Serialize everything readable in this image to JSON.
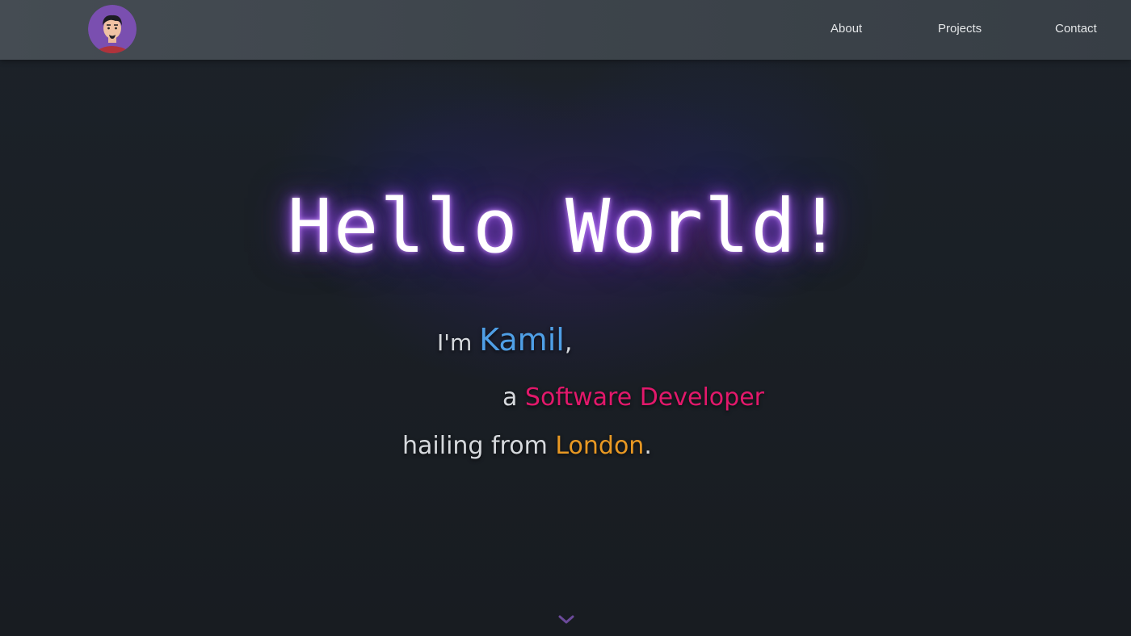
{
  "nav": {
    "links": [
      {
        "label": "About"
      },
      {
        "label": "Projects"
      },
      {
        "label": "Contact"
      }
    ]
  },
  "hero": {
    "title": "Hello World!",
    "line1": {
      "prefix": "I'm ",
      "name": "Kamil",
      "suffix": ","
    },
    "line2": {
      "prefix": "a ",
      "role": "Software Developer"
    },
    "line3": {
      "prefix": "hailing from ",
      "city": "London",
      "suffix": "."
    }
  },
  "colors": {
    "name": "#4f9fe6",
    "role": "#e2186b",
    "city": "#e89823",
    "glow": "#a85cff"
  },
  "icons": {
    "avatar": "user-avatar-icon",
    "scroll": "chevron-down-icon"
  }
}
